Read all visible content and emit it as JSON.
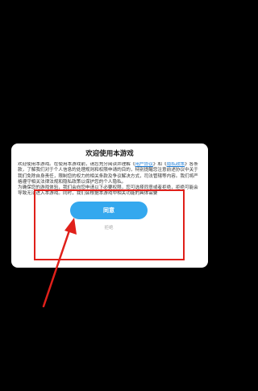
{
  "dialog": {
    "title": "欢迎使用本游戏",
    "body": {
      "p1_before": "欢迎使用本游戏。在使用本游戏前，请您充分阅读并理解《",
      "link_user_agreement": "用户协议",
      "p1_mid": "》和《",
      "link_privacy_policy": "隐私政策",
      "p1_after": "》各条款，了解我们对于个人信息的处理规则和权限申请的目的，特别提醒您注意前述协议中关于我们免除自身责任，限制您的权力的相关条款及争议解决方式，司法管辖等内容。我们将严格遵守相关法律法规和隐私政策以保护您的个人隐私。",
      "p2": "为确保您的游戏体验，我们会向您申请以下必要权限，您可选择同意或者拒绝，拒绝可能会导致无法进入本游戏。同时，我们会根据本游戏中相关功能的具体需要"
    },
    "agree_label": "同意",
    "decline_label": "拒绝"
  },
  "annotation": {
    "box_color": "#e0201a",
    "arrow_color": "#e0201a"
  }
}
